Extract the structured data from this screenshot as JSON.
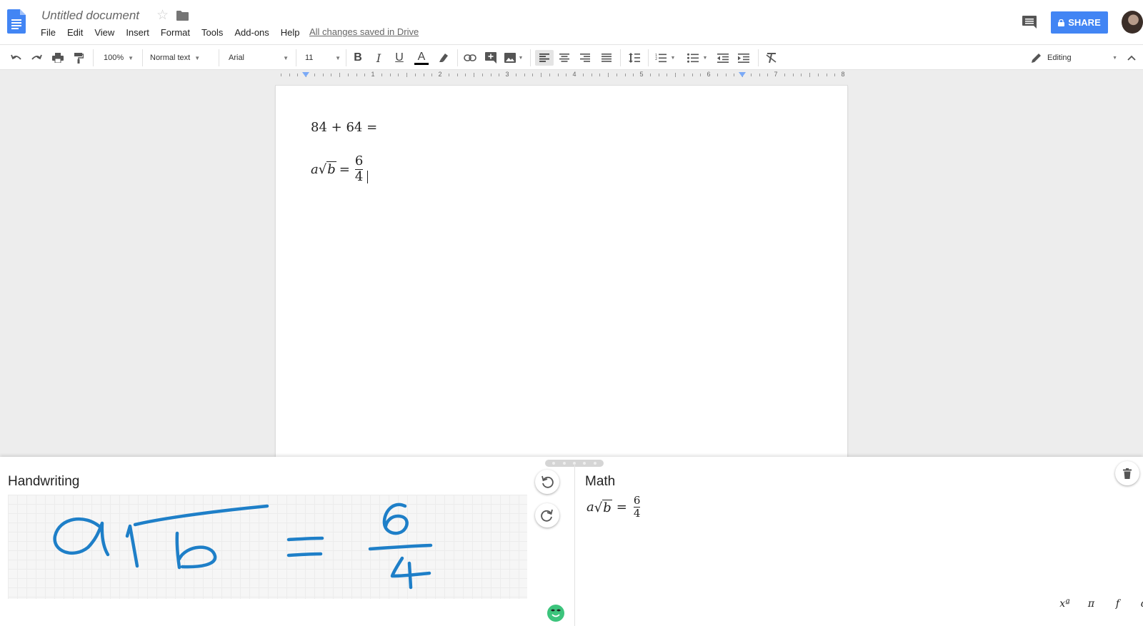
{
  "header": {
    "doc_title": "Untitled document",
    "menu": [
      "File",
      "Edit",
      "View",
      "Insert",
      "Format",
      "Tools",
      "Add-ons",
      "Help"
    ],
    "save_status": "All changes saved in Drive",
    "share_label": "SHARE",
    "colors": {
      "share_bg": "#4285f4",
      "docs_blue": "#4285f4"
    }
  },
  "toolbar": {
    "zoom": "100%",
    "style": "Normal text",
    "font": "Arial",
    "font_size": "11",
    "bold": "B",
    "italic": "I",
    "underline": "U",
    "text_color": "A",
    "mode": "Editing"
  },
  "ruler": {
    "numbers": [
      "1",
      "2",
      "3",
      "4",
      "5",
      "6",
      "7",
      "8"
    ]
  },
  "document": {
    "equation1": {
      "a": "84",
      "op": "+",
      "b": "64",
      "eq": "="
    },
    "equation2": {
      "coef": "a",
      "radicand": "b",
      "eq": "=",
      "numerator": "6",
      "denominator": "4"
    }
  },
  "panel": {
    "handwriting_title": "Handwriting",
    "math_title": "Math",
    "result": {
      "coef": "a",
      "radicand": "b",
      "eq": "=",
      "numerator": "6",
      "denominator": "4"
    },
    "symbols": [
      "xª",
      "π",
      "f",
      "α"
    ],
    "ink_color": "#1e7fc8"
  }
}
